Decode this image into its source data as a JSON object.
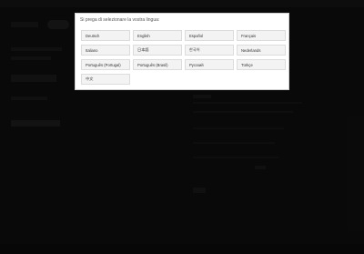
{
  "dialog": {
    "title": "Si prega di selezionare la vostra lingua:",
    "languages": [
      "Deutsch",
      "English",
      "Español",
      "Français",
      "Italiano",
      "日本語",
      "한국어",
      "Nederlands",
      "Português (Portugal)",
      "Português (Brasil)",
      "Pусский",
      "Türkçe",
      "中文"
    ]
  },
  "colors": {
    "overlay": "#000000",
    "dialog_background": "#ffffff",
    "button_background": "#f3f3f3"
  }
}
